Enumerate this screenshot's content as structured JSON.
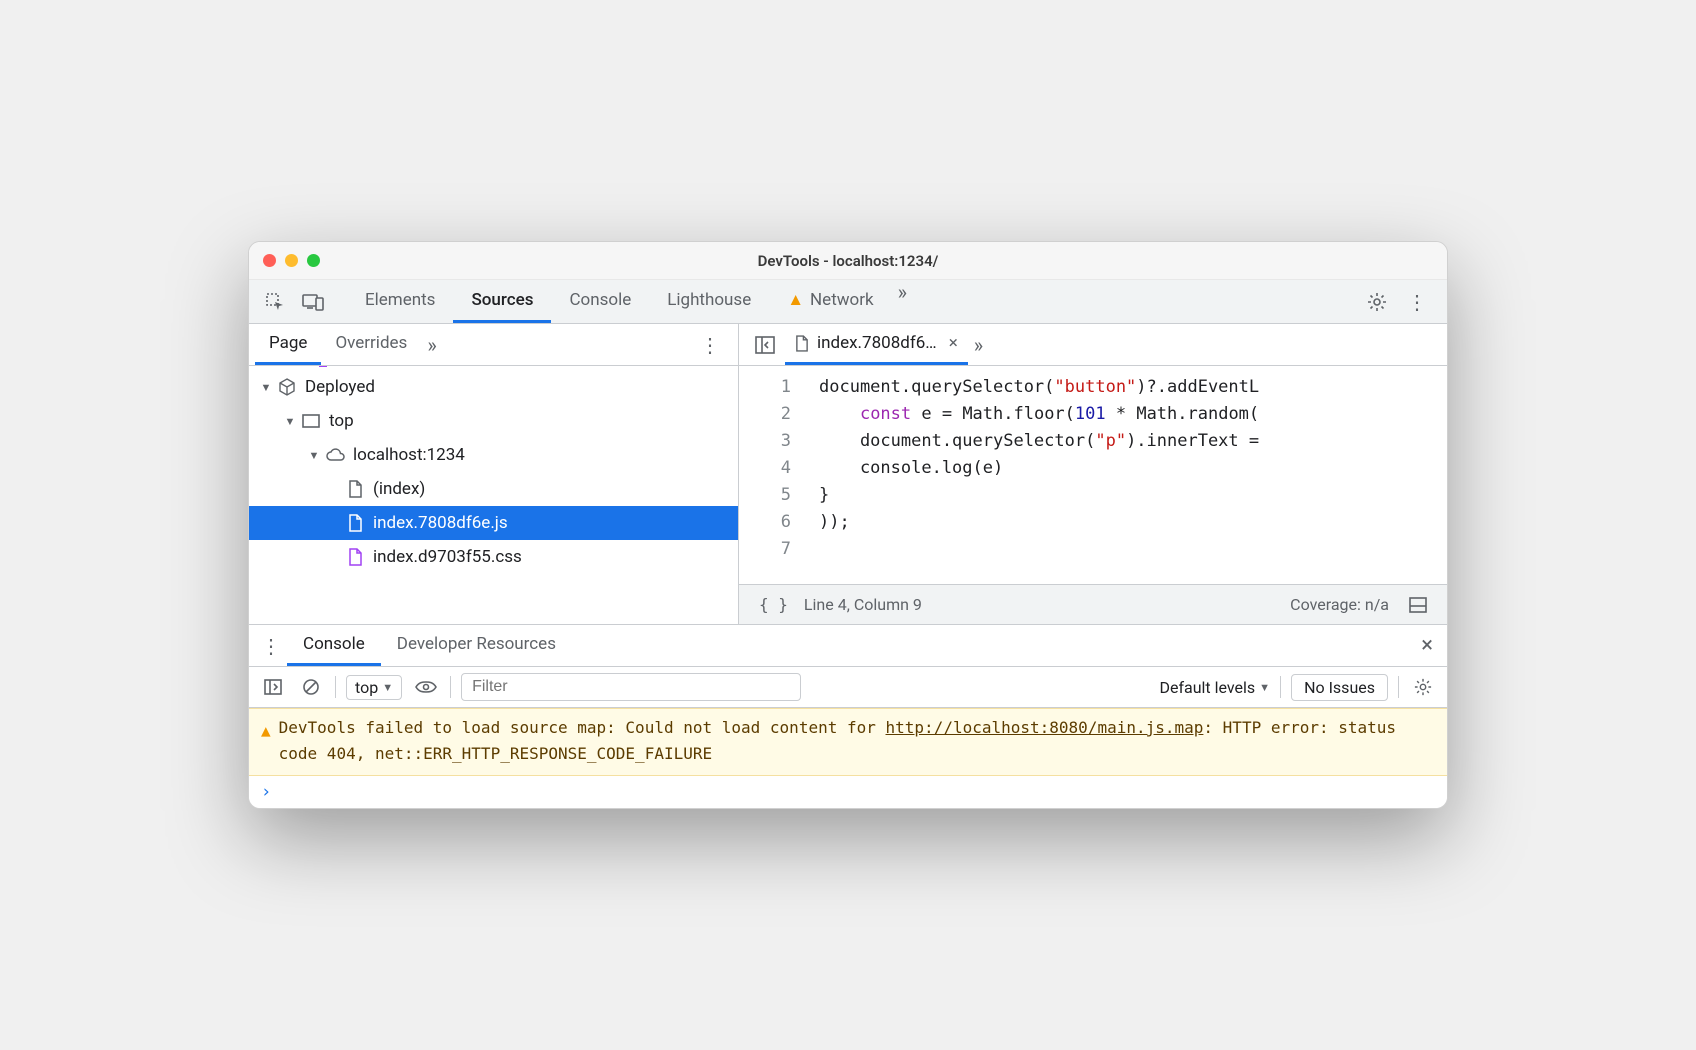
{
  "window": {
    "title": "DevTools - localhost:1234/"
  },
  "mainTabs": {
    "items": [
      "Elements",
      "Sources",
      "Console",
      "Lighthouse",
      "Network"
    ],
    "active": 1,
    "networkHasWarning": true
  },
  "sourcesSidebar": {
    "tabs": [
      "Page",
      "Overrides"
    ],
    "active": 0,
    "tree": {
      "deployed": "Deployed",
      "top": "top",
      "origin": "localhost:1234",
      "files": {
        "index": "(index)",
        "js": "index.7808df6e.js",
        "css": "index.d9703f55.css"
      }
    }
  },
  "editor": {
    "openFileTab": "index.7808df6…",
    "lines": [
      {
        "n": 1,
        "segs": [
          [
            "document.querySelector(",
            ""
          ],
          [
            "\"button\"",
            "str"
          ],
          [
            ")?.addEventL",
            ""
          ]
        ]
      },
      {
        "n": 2,
        "segs": [
          [
            "    ",
            ""
          ],
          [
            "const",
            "kw"
          ],
          [
            " e = Math.floor(",
            ""
          ],
          [
            "101",
            "num"
          ],
          [
            " * Math.random(",
            ""
          ]
        ]
      },
      {
        "n": 3,
        "segs": [
          [
            "    document.querySelector(",
            ""
          ],
          [
            "\"p\"",
            "str"
          ],
          [
            ").innerText =",
            ""
          ]
        ]
      },
      {
        "n": 4,
        "segs": [
          [
            "    console.log(e)",
            ""
          ]
        ]
      },
      {
        "n": 5,
        "segs": [
          [
            "}",
            ""
          ]
        ]
      },
      {
        "n": 6,
        "segs": [
          [
            "));",
            ""
          ]
        ]
      },
      {
        "n": 7,
        "segs": [
          [
            "",
            ""
          ]
        ]
      }
    ],
    "status": {
      "pos": "Line 4, Column 9",
      "coverage": "Coverage: n/a"
    }
  },
  "drawer": {
    "tabs": [
      "Console",
      "Developer Resources"
    ],
    "active": 0
  },
  "consoleToolbar": {
    "context": "top",
    "filterPlaceholder": "Filter",
    "levels": "Default levels",
    "issues": "No Issues"
  },
  "consoleMessages": {
    "warning": {
      "prefix": "DevTools failed to load source map: Could not load content for ",
      "url": "http://localhost:8080/main.js.map",
      "suffix": ": HTTP error: status code 404, net::ERR_HTTP_RESPONSE_CODE_FAILURE"
    }
  }
}
